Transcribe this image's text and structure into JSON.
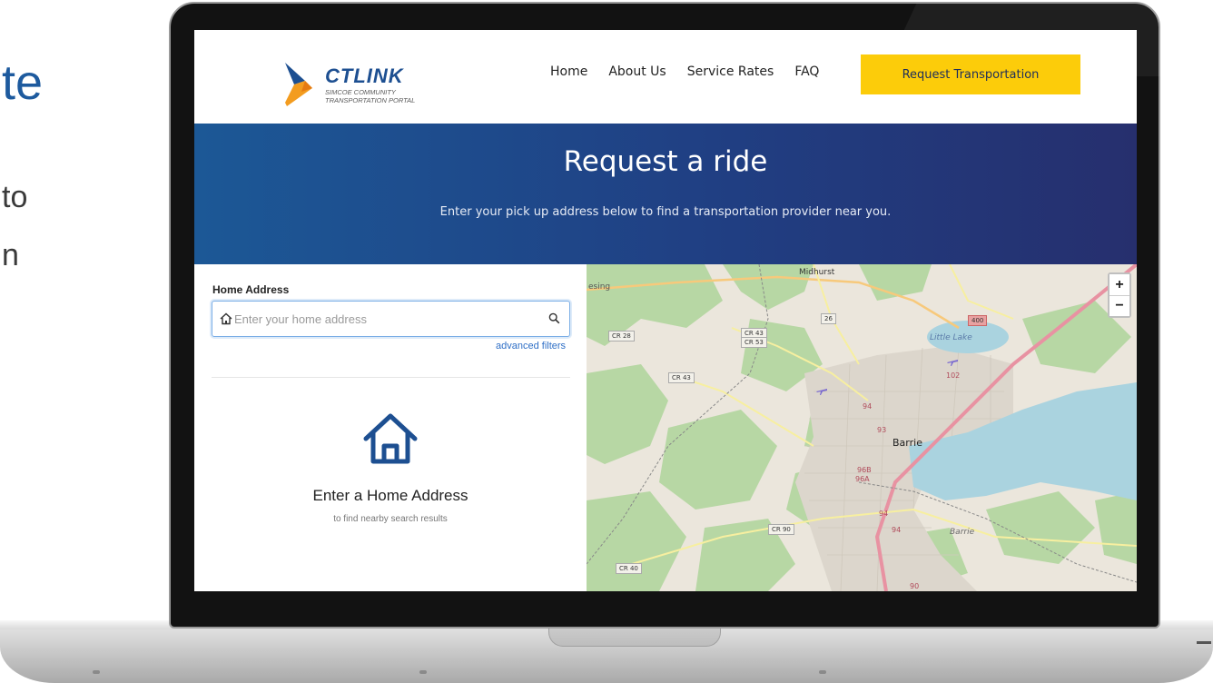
{
  "slide": {
    "title_fragment": "te",
    "line1_fragment": "to",
    "line2_fragment": "n"
  },
  "logo": {
    "name": "CTLINK",
    "subtitle_line1": "SIMCOE COMMUNITY",
    "subtitle_line2": "TRANSPORTATION PORTAL"
  },
  "nav": {
    "items": [
      {
        "label": "Home"
      },
      {
        "label": "About Us"
      },
      {
        "label": "Service Rates"
      },
      {
        "label": "FAQ"
      }
    ],
    "cta_label": "Request Transportation"
  },
  "hero": {
    "title": "Request a ride",
    "subtitle": "Enter your pick up address below to find a transportation provider near you."
  },
  "search": {
    "label": "Home Address",
    "placeholder": "Enter your home address",
    "value": "",
    "advanced_filters_label": "advanced filters"
  },
  "empty_state": {
    "title": "Enter a Home Address",
    "subtitle": "to find nearby search results"
  },
  "map": {
    "zoom_in": "+",
    "zoom_out": "−",
    "places": {
      "midhurst": "Midhurst",
      "barrie": "Barrie",
      "barrie_small": "Barrie",
      "little_lake": "Little Lake",
      "esing": "esing"
    },
    "road_labels": {
      "cr28": "CR 28",
      "cr43a": "CR 43",
      "cr53": "CR 53",
      "cr43b": "CR 43",
      "cr90": "CR 90",
      "cr40": "CR 40",
      "hwy26": "26",
      "hwy400": "400",
      "hwy102": "102",
      "hwy94a": "94",
      "hwy94b": "94",
      "hwy94c": "94",
      "hwy93": "93",
      "hwy96b": "96B",
      "hwy96a": "96A",
      "hwy90": "90"
    }
  },
  "colors": {
    "brand_blue": "#1d4f91",
    "brand_yellow": "#fccc0a",
    "link_blue": "#2f6fc6"
  }
}
